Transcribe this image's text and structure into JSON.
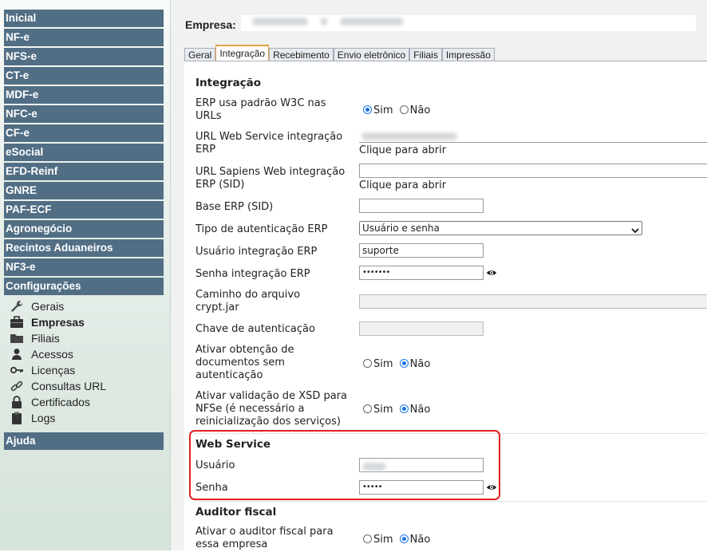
{
  "sidebar": {
    "items": [
      {
        "label": "Inicial"
      },
      {
        "label": "NF-e"
      },
      {
        "label": "NFS-e"
      },
      {
        "label": "CT-e"
      },
      {
        "label": "MDF-e"
      },
      {
        "label": "NFC-e"
      },
      {
        "label": "CF-e"
      },
      {
        "label": "eSocial"
      },
      {
        "label": "EFD-Reinf"
      },
      {
        "label": "GNRE"
      },
      {
        "label": "PAF-ECF"
      },
      {
        "label": "Agronegócio"
      },
      {
        "label": "Recintos Aduaneiros"
      },
      {
        "label": "NF3-e"
      },
      {
        "label": "Configurações"
      }
    ],
    "config_sub": [
      {
        "label": "Gerais",
        "icon": "wrench-icon"
      },
      {
        "label": "Empresas",
        "icon": "briefcase-icon"
      },
      {
        "label": "Filiais",
        "icon": "folder-icon"
      },
      {
        "label": "Acessos",
        "icon": "user-icon"
      },
      {
        "label": "Licenças",
        "icon": "key-icon"
      },
      {
        "label": "Consultas URL",
        "icon": "link-icon"
      },
      {
        "label": "Certificados",
        "icon": "lock-icon"
      },
      {
        "label": "Logs",
        "icon": "clipboard-icon"
      }
    ],
    "help": "Ajuda"
  },
  "company": {
    "label": "Empresa:"
  },
  "tabs": [
    {
      "label": "Geral"
    },
    {
      "label": "Integração"
    },
    {
      "label": "Recebimento"
    },
    {
      "label": "Envio eletrônico"
    },
    {
      "label": "Filiais"
    },
    {
      "label": "Impressão"
    }
  ],
  "integration": {
    "title": "Integração",
    "erp_w3c_label": "ERP usa padrão W3C nas URLs",
    "url_ws_label": "URL Web Service integração ERP",
    "url_sapiens_label": "URL Sapiens Web integração ERP (SID)",
    "open_link": "Clique para abrir",
    "base_erp_label": "Base ERP (SID)",
    "auth_type_label": "Tipo de autenticação ERP",
    "auth_type_value": "Usuário e senha",
    "user_label": "Usuário integração ERP",
    "user_value": "suporte",
    "password_label": "Senha integração ERP",
    "password_value": "•••••••",
    "crypt_label": "Caminho do arquivo crypt.jar",
    "auth_key_label": "Chave de autenticação",
    "docs_no_auth_label": "Ativar obtenção de documentos sem autenticação",
    "xsd_label": "Ativar validação de XSD para NFSe (é necessário a reinicialização dos serviços)",
    "yes": "Sim",
    "no": "Não"
  },
  "webservice": {
    "title": "Web Service",
    "user_label": "Usuário",
    "password_label": "Senha",
    "password_value": "•••••"
  },
  "auditor": {
    "title": "Auditor fiscal",
    "enable_label": "Ativar o auditor fiscal para essa empresa"
  },
  "colors": {
    "nav_bg": "#516e85",
    "tab_accent": "#e2a04a",
    "highlight": "#e02020",
    "radio": "#1a73e8"
  }
}
